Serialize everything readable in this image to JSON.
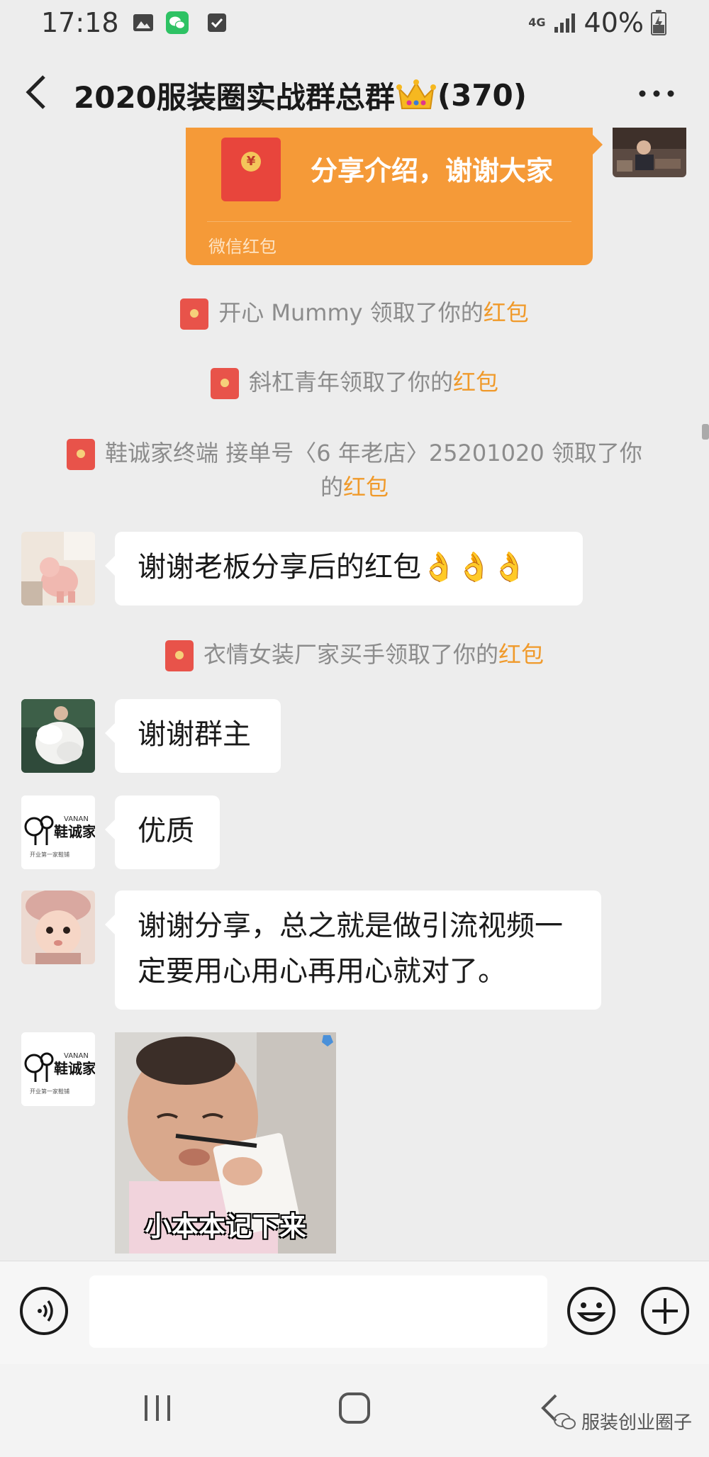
{
  "status_bar": {
    "time": "17:18",
    "network": "4G",
    "battery": "40%",
    "icons": [
      "gallery-icon",
      "wechat-icon",
      "checkbox-icon",
      "signal-icon",
      "battery-icon"
    ]
  },
  "header": {
    "title": "2020服装圈实战群总群",
    "member_count": "(370)",
    "back_icon": "chevron-left-icon",
    "more_icon": "more-dots-icon"
  },
  "red_packet": {
    "message": "分享介绍，谢谢大家",
    "label": "微信红包"
  },
  "system_messages": [
    {
      "prefix": "开心 Mummy 领取了你的",
      "link": "红包"
    },
    {
      "prefix": "斜杠青年领取了你的",
      "link": "红包"
    },
    {
      "line1": "鞋诚家终端 接单号〈6 年老店〉25201020 领取了你",
      "line2_prefix": "的",
      "link": "红包"
    },
    {
      "prefix": "衣情女装厂家买手领取了你的",
      "link": "红包"
    }
  ],
  "messages": [
    {
      "text": "谢谢老板分享后的红包👌👌👌"
    },
    {
      "text": "谢谢群主"
    },
    {
      "text": "优质"
    },
    {
      "line1": "谢谢分享，总之就是做引流视频一",
      "line2": "定要用心用心再用心就对了。"
    }
  ],
  "avatars": {
    "shoe_logo_top": "VANAN",
    "shoe_logo_main": "鞋诚家",
    "shoe_logo_sub": "开业第一家鞋铺"
  },
  "sticker": {
    "caption": "小本本记下来"
  },
  "input_bar": {
    "placeholder": "",
    "voice_icon": "voice-icon",
    "emoji_icon": "emoji-icon",
    "plus_icon": "plus-icon"
  },
  "watermark": "服装创业圈子"
}
